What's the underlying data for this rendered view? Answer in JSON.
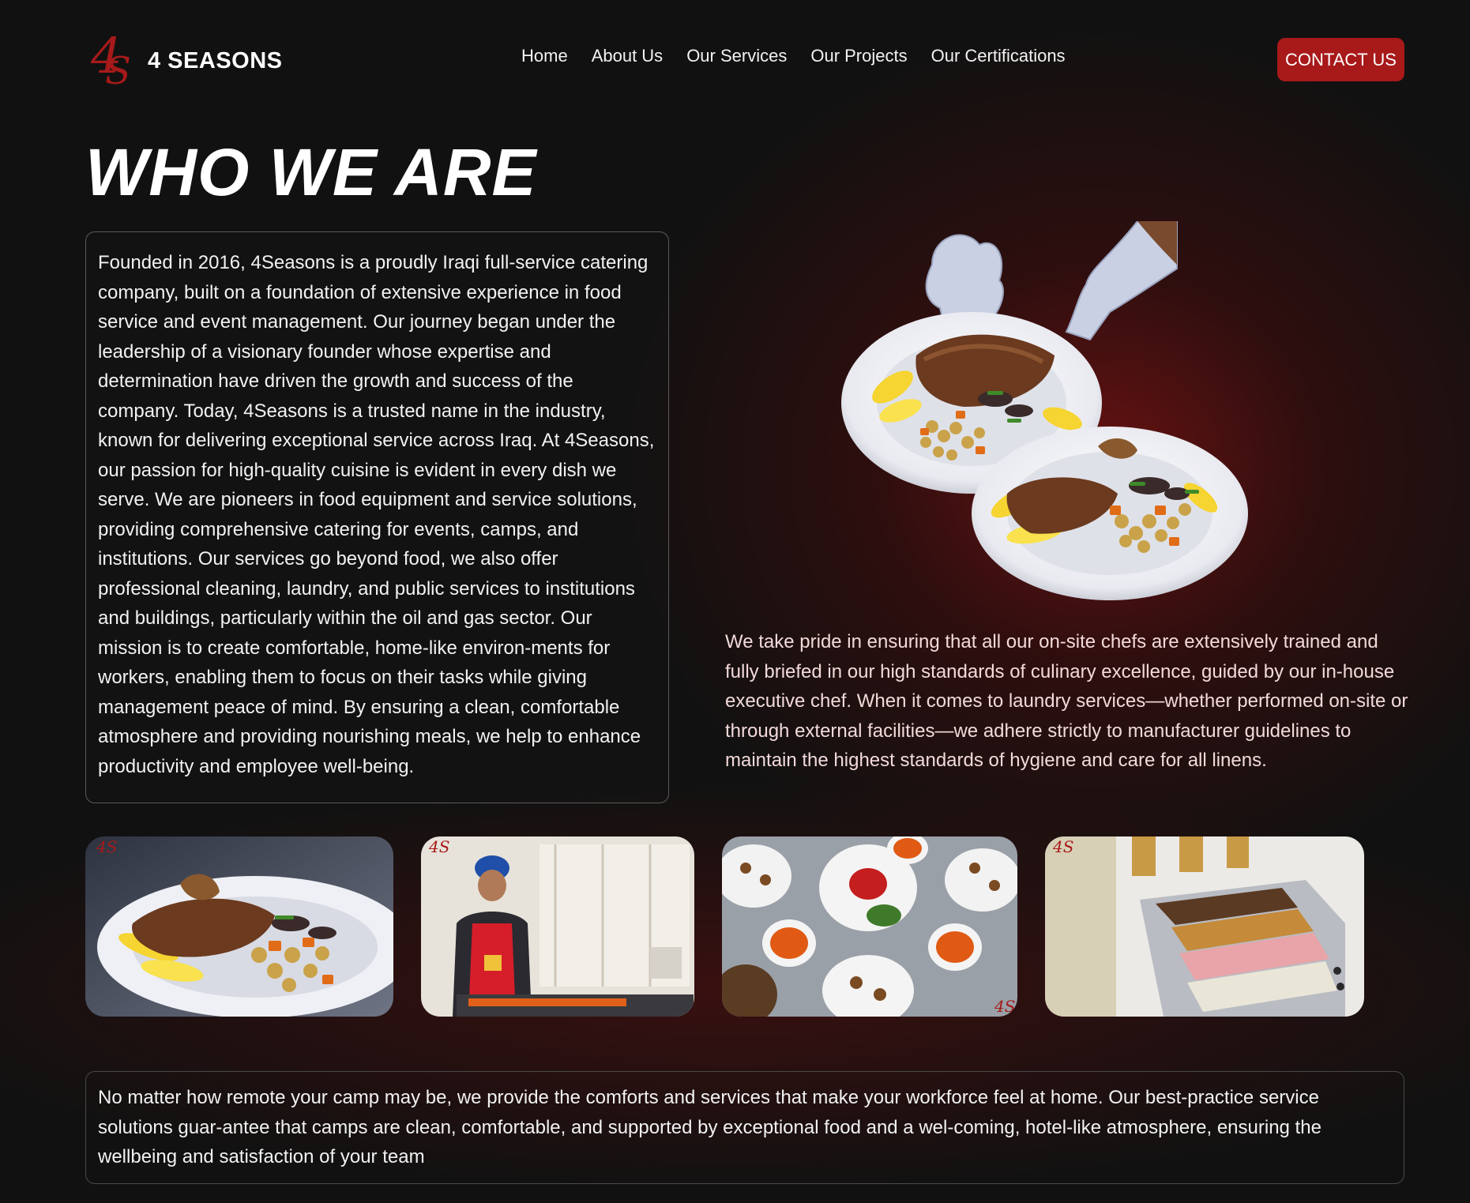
{
  "brand": {
    "name": "4 SEASONS",
    "accent_color": "#a8191a"
  },
  "nav": {
    "items": [
      {
        "label": "Home"
      },
      {
        "label": "About Us"
      },
      {
        "label": "Our Services"
      },
      {
        "label": "Our Projects"
      },
      {
        "label": "Our Certifications"
      }
    ],
    "contact_label": "CONTACT US"
  },
  "main": {
    "title": "WHO WE ARE",
    "about_text": "Founded in 2016, 4Seasons is a proudly Iraqi full-service catering company, built on a foundation of extensive experience in food service and event management. Our journey began under the leadership of a visionary founder whose expertise and determination have driven the growth and success of the company. Today, 4Seasons is a trusted name in the industry, known for delivering exceptional service across Iraq. At 4Seasons, our passion for high-quality cuisine is evident in every dish we serve. We are pioneers in food equipment and service solutions, providing comprehensive catering for events, camps, and institutions. Our services go beyond food, we also offer professional cleaning, laundry, and public services to institutions and buildings, particularly within the oil and gas sector. Our mission is to create comfortable, home-like environ-ments for workers, enabling them to focus on their tasks while giving management peace of mind. By ensuring a clean, comfortable atmosphere and providing nourishing meals, we help to enhance productivity and employee well-being.",
    "chef_text": "We take pride in ensuring that all our on-site chefs are extensively trained and fully briefed in our high standards of culinary excellence, guided by our in-house executive chef. When it comes to laundry services—whether performed on-site or through external facilities—we adhere strictly to manufacturer guidelines to maintain the highest standards of hygiene and care for all linens.",
    "bottom_text": "No matter how remote your camp may be, we provide the comforts and services that make your workforce feel at home. Our best-practice service solutions guar-antee that camps are clean, comfortable, and supported by exceptional food and a wel-coming, hotel-like atmosphere, ensuring the wellbeing and satisfaction of your team"
  },
  "gallery": {
    "watermark": "4S"
  }
}
